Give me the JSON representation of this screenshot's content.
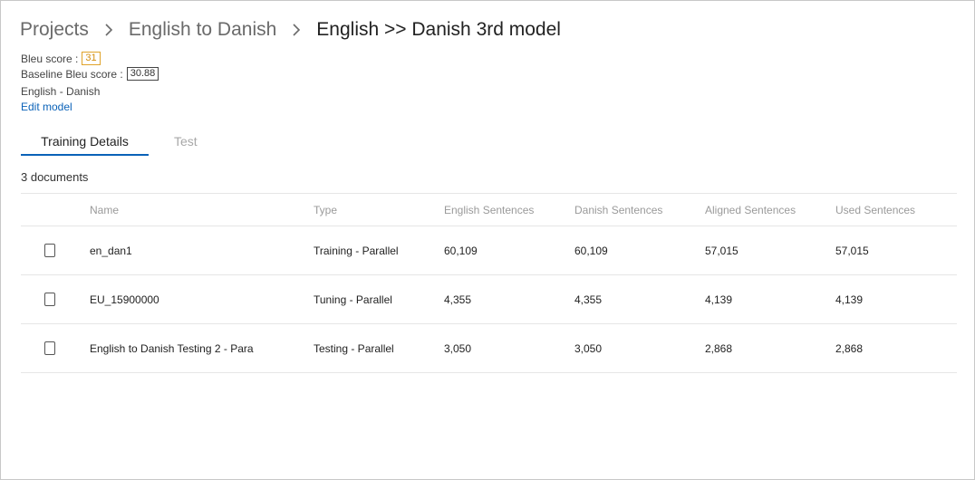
{
  "breadcrumb": {
    "items": [
      "Projects",
      "English to Danish"
    ],
    "current": "English >> Danish 3rd model"
  },
  "model": {
    "bleu_label": "Bleu score :",
    "bleu_value": "31",
    "baseline_label": "Baseline Bleu score :",
    "baseline_value": "30.88",
    "language_pair": "English - Danish",
    "edit_label": "Edit model"
  },
  "tabs": [
    {
      "label": "Training Details",
      "active": true
    },
    {
      "label": "Test",
      "active": false
    }
  ],
  "documents": {
    "count_label": "3 documents",
    "columns": [
      "Name",
      "Type",
      "English Sentences",
      "Danish Sentences",
      "Aligned Sentences",
      "Used Sentences"
    ],
    "rows": [
      {
        "name": "en_dan1",
        "type": "Training - Parallel",
        "english": "60,109",
        "danish": "60,109",
        "aligned": "57,015",
        "used": "57,015"
      },
      {
        "name": "EU_15900000",
        "type": "Tuning - Parallel",
        "english": "4,355",
        "danish": "4,355",
        "aligned": "4,139",
        "used": "4,139"
      },
      {
        "name": "English to Danish Testing 2 - Para",
        "type": "Testing - Parallel",
        "english": "3,050",
        "danish": "3,050",
        "aligned": "2,868",
        "used": "2,868"
      }
    ]
  },
  "colors": {
    "accent": "#0a62b8",
    "bleu_badge": "#e0a32a"
  }
}
